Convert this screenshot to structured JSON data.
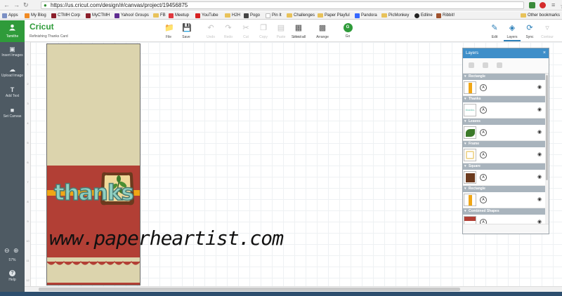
{
  "browser": {
    "url": "https://us.cricut.com/design/#/canvas/project/19456875",
    "bookmarks": [
      "Apps",
      "My Blog",
      "CTMH Corp",
      "MyCTMH",
      "Yahoo! Groups",
      "FB",
      "Meetup",
      "YouTube",
      "H2H",
      "Pogo",
      "Pin It",
      "Challenges",
      "Paper Playful",
      "Pandora",
      "PicMonkey",
      "Edline",
      "Ribbit!"
    ],
    "other_bookmarks": "Other bookmarks"
  },
  "app": {
    "logo": "Cricut",
    "project_name": "Refinishing Thanks Card",
    "user_name": "Tamithe"
  },
  "toolbar": {
    "file": "File",
    "save": "Save",
    "undo": "Undo",
    "redo": "Redo",
    "cut": "Cut",
    "copy": "Copy",
    "paste": "Paste",
    "delete": "Delete",
    "select_all": "Select all",
    "arrange": "Arrange",
    "go": "Go",
    "go_badge": "G",
    "edit": "Edit",
    "layers": "Layers",
    "sync": "Sync",
    "contour": "Contour"
  },
  "sidebar": {
    "insert_images": "Insert Images",
    "upload_image": "Upload Image",
    "add_text": "Add Text",
    "set_canvas": "Set Canvas",
    "zoom": "57%",
    "help": "Help"
  },
  "ruler": [
    "1",
    "2",
    "3",
    "4",
    "5",
    "6",
    "7",
    "8",
    "9",
    "10",
    "11",
    "12"
  ],
  "design": {
    "word": "thanks",
    "watermark": "www.paperheartist.com"
  },
  "layers_panel": {
    "title": "Layers",
    "close": "×",
    "groups": [
      {
        "label": "Rectangle",
        "thumb_color": "#f0a615",
        "thumb_kind": "bar"
      },
      {
        "label": "Thanks",
        "thumb_color": "#8fd0c2",
        "thumb_kind": "text",
        "thumb_text": "thanks"
      },
      {
        "label": "Leaves",
        "thumb_color": "#3c7a2a",
        "thumb_kind": "leaf"
      },
      {
        "label": "Frame",
        "thumb_color": "#f0d99a",
        "thumb_kind": "frame"
      },
      {
        "label": "Square",
        "thumb_color": "#6b3a1e",
        "thumb_kind": "square"
      },
      {
        "label": "Rectangle",
        "thumb_color": "#f0a615",
        "thumb_kind": "bar"
      },
      {
        "label": "Combined Shapes",
        "thumb_color": "#b23f35",
        "thumb_kind": "partial"
      }
    ]
  }
}
